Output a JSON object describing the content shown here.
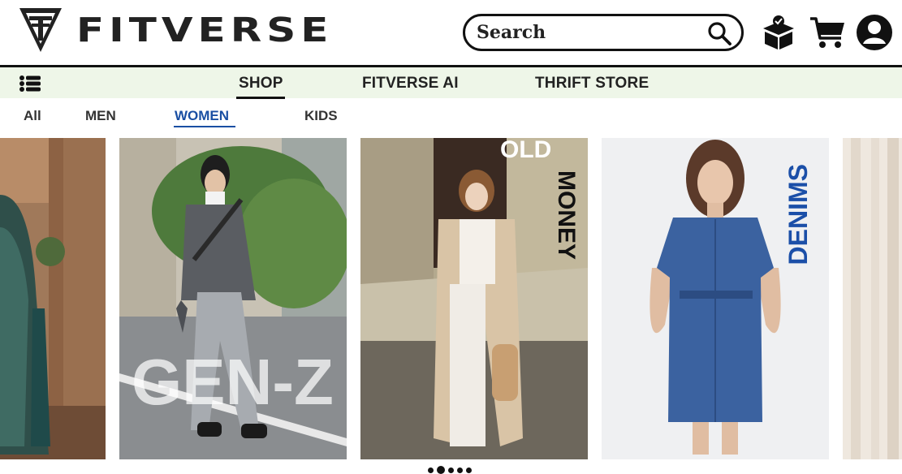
{
  "brand": {
    "name": "FITVERSE"
  },
  "search": {
    "placeholder": "Search"
  },
  "header_icons": [
    "package-check-icon",
    "cart-icon",
    "account-icon"
  ],
  "nav": {
    "items": [
      {
        "label": "SHOP",
        "active": true
      },
      {
        "label": "FITVERSE AI",
        "active": false
      },
      {
        "label": "THRIFT STORE",
        "active": false
      }
    ]
  },
  "subnav": {
    "items": [
      {
        "label": "All",
        "active": false
      },
      {
        "label": "MEN",
        "active": false
      },
      {
        "label": "WOMEN",
        "active": true
      },
      {
        "label": "KIDS",
        "active": false
      }
    ]
  },
  "carousel": {
    "cards": [
      {
        "overlay": ""
      },
      {
        "overlay": "GEN-Z"
      },
      {
        "overlay_top": "OLD",
        "overlay_side": "MONEY"
      },
      {
        "overlay": "DENIMS"
      },
      {
        "overlay": ""
      }
    ],
    "page_count": 5,
    "active_page": 2
  },
  "colors": {
    "accent": "#1a4fa3",
    "nav_bg": "#eef6e8",
    "text": "#222222"
  }
}
